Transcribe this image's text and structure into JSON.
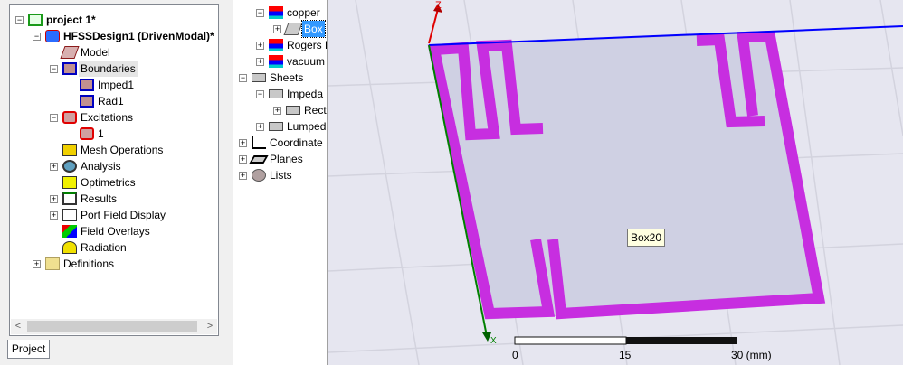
{
  "project_tree": [
    {
      "label": "project  1*",
      "level": 0,
      "exp": "-",
      "icon": "project-icon",
      "bold": true
    },
    {
      "label": "HFSSDesign1 (DrivenModal)*",
      "level": 1,
      "exp": "-",
      "icon": "hfss-design-icon",
      "bold": true
    },
    {
      "label": "Model",
      "level": 2,
      "exp": "",
      "icon": "model-icon"
    },
    {
      "label": "Boundaries",
      "level": 2,
      "exp": "-",
      "icon": "boundaries-icon",
      "hl": true
    },
    {
      "label": "Imped1",
      "level": 3,
      "exp": "",
      "icon": "boundary-icon"
    },
    {
      "label": "Rad1",
      "level": 3,
      "exp": "",
      "icon": "boundary-icon"
    },
    {
      "label": "Excitations",
      "level": 2,
      "exp": "-",
      "icon": "excitations-icon"
    },
    {
      "label": "1",
      "level": 3,
      "exp": "",
      "icon": "excitation-icon"
    },
    {
      "label": "Mesh Operations",
      "level": 2,
      "exp": "",
      "icon": "mesh-icon"
    },
    {
      "label": "Analysis",
      "level": 2,
      "exp": "+",
      "icon": "analysis-icon"
    },
    {
      "label": "Optimetrics",
      "level": 2,
      "exp": "",
      "icon": "optimetrics-icon"
    },
    {
      "label": "Results",
      "level": 2,
      "exp": "+",
      "icon": "results-icon"
    },
    {
      "label": "Port Field Display",
      "level": 2,
      "exp": "+",
      "icon": "port-field-icon"
    },
    {
      "label": "Field Overlays",
      "level": 2,
      "exp": "",
      "icon": "field-overlays-icon"
    },
    {
      "label": "Radiation",
      "level": 2,
      "exp": "",
      "icon": "radiation-icon"
    },
    {
      "label": "Definitions",
      "level": 1,
      "exp": "+",
      "icon": "folder-icon"
    }
  ],
  "model_tree": [
    {
      "label": "copper",
      "level": 1,
      "exp": "-",
      "icon": "material-icon"
    },
    {
      "label": "Box",
      "level": 2,
      "exp": "+",
      "icon": "box-icon",
      "selected": true
    },
    {
      "label": "Rogers R",
      "level": 1,
      "exp": "+",
      "icon": "material-icon"
    },
    {
      "label": "vacuum",
      "level": 1,
      "exp": "+",
      "icon": "material-icon"
    },
    {
      "label": "Sheets",
      "level": 0,
      "exp": "-",
      "icon": "sheet-icon"
    },
    {
      "label": "Impeda",
      "level": 1,
      "exp": "-",
      "icon": "sheet-icon"
    },
    {
      "label": "Rect",
      "level": 2,
      "exp": "+",
      "icon": "sheet-icon"
    },
    {
      "label": "Lumped",
      "level": 1,
      "exp": "+",
      "icon": "sheet-icon"
    },
    {
      "label": "Coordinate",
      "level": 0,
      "exp": "+",
      "icon": "coordinate-icon"
    },
    {
      "label": "Planes",
      "level": 0,
      "exp": "+",
      "icon": "planes-icon"
    },
    {
      "label": "Lists",
      "level": 0,
      "exp": "+",
      "icon": "lists-icon"
    }
  ],
  "tab_label": "Project",
  "viewport": {
    "axis_z": "Z",
    "axis_x": "X",
    "tooltip": "Box20",
    "scale": {
      "t0": "0",
      "t1": "15",
      "t2": "30 (mm)"
    },
    "colors": {
      "conductor": "#c72ee0",
      "substrate": "#cfd0e3",
      "background": "#e6e6f0"
    }
  }
}
